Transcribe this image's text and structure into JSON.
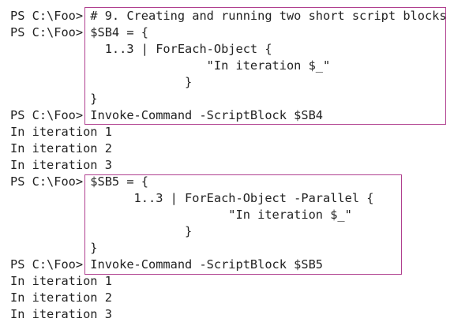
{
  "console": {
    "lines": [
      "PS C:\\Foo> # 9. Creating and running two short script blocks",
      "PS C:\\Foo> $SB4 = {",
      "             1..3 | ForEach-Object {",
      "                           \"In iteration $_\"",
      "                        }",
      "           }",
      "PS C:\\Foo> Invoke-Command -ScriptBlock $SB4",
      "In iteration 1",
      "In iteration 2",
      "In iteration 3",
      "PS C:\\Foo> $SB5 = {",
      "                 1..3 | ForEach-Object -Parallel {",
      "                              \"In iteration $_\"",
      "                        }",
      "           }",
      "PS C:\\Foo> Invoke-Command -ScriptBlock $SB5",
      "In iteration 1",
      "In iteration 2",
      "In iteration 3"
    ]
  },
  "highlight_color": "#b0408f"
}
